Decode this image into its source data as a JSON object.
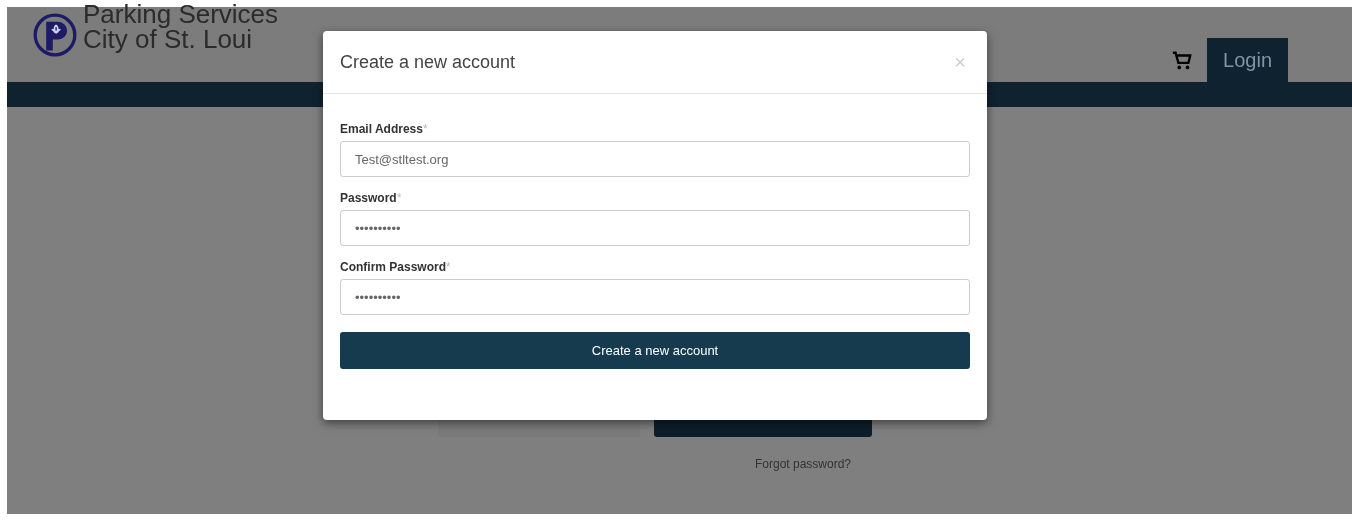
{
  "header": {
    "title_line_1": "Parking Services",
    "title_line_2": "City of St. Loui",
    "login": "Login"
  },
  "background": {
    "forgot_password": "Forgot password?"
  },
  "modal": {
    "title": "Create a new account",
    "close": "×",
    "fields": [
      {
        "label": "Email Address",
        "required": "*",
        "value": "Test@stltest.org"
      },
      {
        "label": "Password",
        "required": "*",
        "value": "••••••••••"
      },
      {
        "label": "Confirm Password",
        "required": "*",
        "value": "••••••••••"
      }
    ],
    "submit": "Create a new account"
  }
}
